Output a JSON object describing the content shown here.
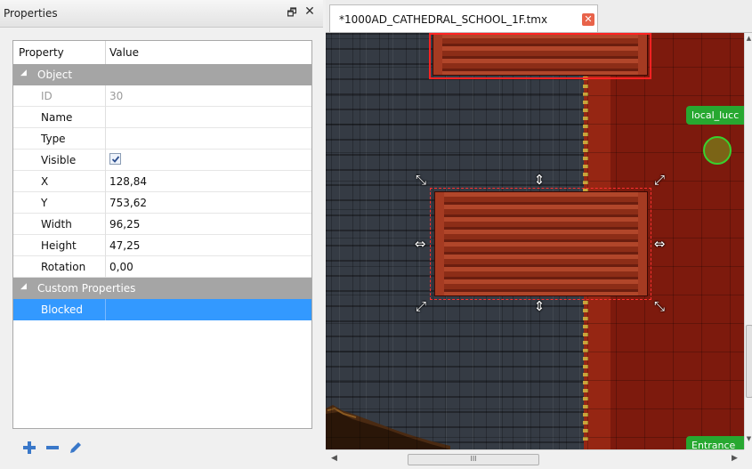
{
  "properties_panel": {
    "title": "Properties",
    "float_glyph": "🗗",
    "close_glyph": "✕",
    "headers": {
      "property": "Property",
      "value": "Value"
    },
    "groups": {
      "object": {
        "label": "Object",
        "toggle_icon": "expanded-triangle"
      },
      "custom": {
        "label": "Custom Properties",
        "toggle_icon": "expanded-triangle"
      }
    },
    "object_rows": [
      {
        "key": "ID",
        "value": "30",
        "disabled": true
      },
      {
        "key": "Name",
        "value": ""
      },
      {
        "key": "Type",
        "value": ""
      },
      {
        "key": "Visible",
        "value": "",
        "checked": true
      },
      {
        "key": "X",
        "value": "128,84"
      },
      {
        "key": "Y",
        "value": "753,62"
      },
      {
        "key": "Width",
        "value": "96,25"
      },
      {
        "key": "Height",
        "value": "47,25"
      },
      {
        "key": "Rotation",
        "value": "0,00"
      }
    ],
    "custom_rows": [
      {
        "key": "Blocked",
        "value": "",
        "selected": true
      }
    ],
    "toolbar": {
      "add_icon": "plus-icon",
      "remove_icon": "minus-icon",
      "edit_icon": "pencil-icon"
    }
  },
  "editor": {
    "tab_label": "*1000AD_CATHEDRAL_SCHOOL_1F.tmx",
    "tab_close_glyph": "✕",
    "map_objects": {
      "local_label": "local_lucc",
      "entrance_label": "Entrance"
    },
    "hscroll_grip": "III"
  },
  "colors": {
    "selection": "#3399ff",
    "group_header": "#a5a5a5",
    "object_label": "#27a830",
    "selection_outline": "#ff2222",
    "tab_close": "#e8634a"
  }
}
